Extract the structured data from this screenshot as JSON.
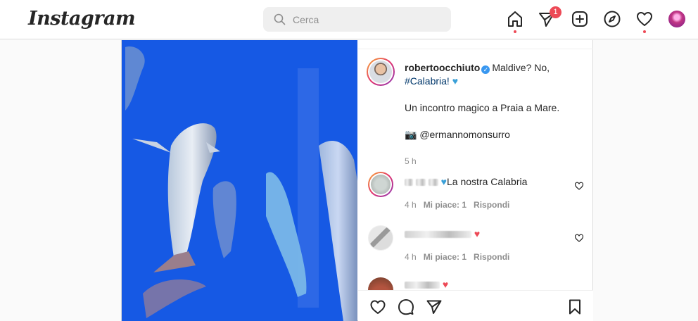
{
  "app": {
    "logo": "Instagram"
  },
  "search": {
    "placeholder": "Cerca",
    "icon": "search-icon"
  },
  "nav": {
    "items": [
      "home-icon",
      "direct-icon",
      "new-post-icon",
      "explore-icon",
      "activity-icon",
      "profile-avatar"
    ],
    "direct_badge": "1",
    "accent": "#ed4956"
  },
  "post": {
    "author": "robertoocchiuto",
    "caption_line1": "Maldive? No,",
    "hashtag": "#Calabria!",
    "caption_line2": "Un incontro magico a Praia a Mare.",
    "credit_icon": "camera-emoji",
    "credit": "@ermannomonsurro",
    "time": "5 h",
    "comments": [
      {
        "text": "La nostra Calabria",
        "heart": "blue-heart-emoji",
        "time": "4 h",
        "likes": "Mi piace: 1",
        "reply": "Rispondi"
      },
      {
        "text": "",
        "heart": "red-heart-emoji",
        "time": "4 h",
        "likes": "Mi piace: 1",
        "reply": "Rispondi"
      },
      {
        "text": "",
        "heart": "red-heart-emoji"
      }
    ]
  },
  "colors": {
    "link": "#00376b",
    "verified": "#3897f0",
    "water": "#1a5ef0"
  }
}
